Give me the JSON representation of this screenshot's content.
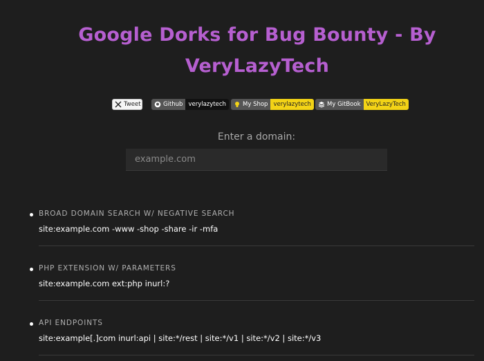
{
  "header": {
    "title_line1": "Google Dorks for Bug Bounty - By",
    "title_line2": "VeryLazyTech"
  },
  "badges": {
    "tweet": {
      "label": "Tweet",
      "icon": "x-logo-icon"
    },
    "github": {
      "left": "Github",
      "right": "verylazytech",
      "icon": "github-icon"
    },
    "shop": {
      "left": "My Shop",
      "right": "verylazytech",
      "icon": "bulb-icon"
    },
    "gitbook": {
      "left": "My GitBook",
      "right": "VeryLazyTech",
      "icon": "book-icon"
    }
  },
  "domain": {
    "label": "Enter a domain:",
    "placeholder": "example.com",
    "value": ""
  },
  "dorks": [
    {
      "title": "BROAD DOMAIN SEARCH W/ NEGATIVE SEARCH",
      "query": "site:example.com -www -shop -share -ir -mfa"
    },
    {
      "title": "PHP EXTENSION W/ PARAMETERS",
      "query": "site:example.com ext:php inurl:?"
    },
    {
      "title": "API ENDPOINTS",
      "query": "site:example[.]com inurl:api | site:*/rest | site:*/v1 | site:*/v2 | site:*/v3"
    }
  ],
  "colors": {
    "background": "#1e1e1e",
    "title": "#b65fd0",
    "badge_accent": "#f3d316"
  }
}
